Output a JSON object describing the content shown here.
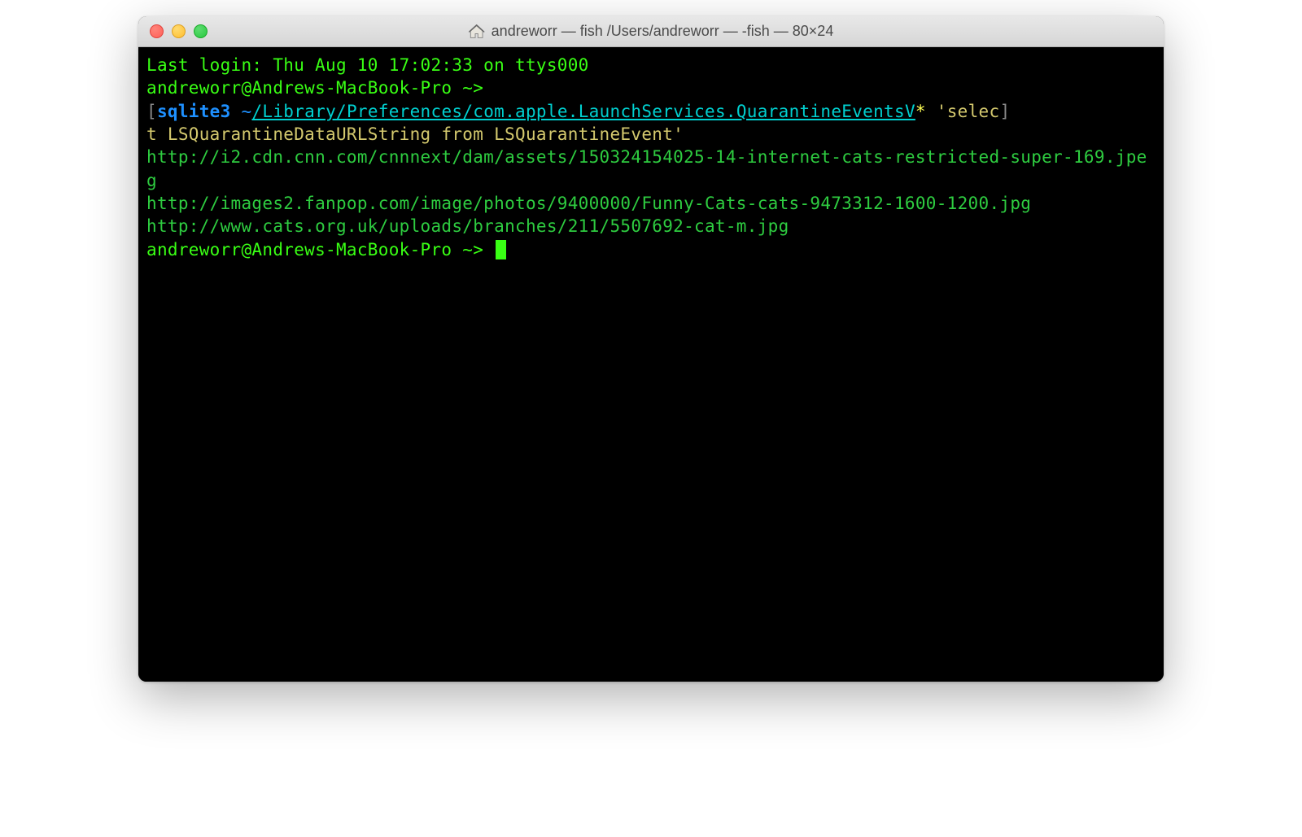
{
  "titlebar": {
    "title": "andreworr — fish  /Users/andreworr — -fish — 80×24"
  },
  "terminal": {
    "last_login": "Last login: Thu Aug 10 17:02:33 on ttys000",
    "prompt1": "andreworr@Andrews-MacBook-Pro ~>",
    "bracket_open": "[",
    "bracket_close": "]",
    "cmd_sqlite": "sqlite3",
    "cmd_tilde": "~",
    "cmd_path": "/Library/Preferences/com.apple.LaunchServices.QuarantineEventsV",
    "cmd_glob": "*",
    "cmd_query_part1": " 'selec",
    "cmd_query_part2": "t LSQuarantineDataURLString from LSQuarantineEvent'",
    "output": [
      "http://i2.cdn.cnn.com/cnnnext/dam/assets/150324154025-14-internet-cats-restricted-super-169.jpeg",
      "http://images2.fanpop.com/image/photos/9400000/Funny-Cats-cats-9473312-1600-1200.jpg",
      "http://www.cats.org.uk/uploads/branches/211/5507692-cat-m.jpg"
    ],
    "prompt2": "andreworr@Andrews-MacBook-Pro ~> "
  }
}
